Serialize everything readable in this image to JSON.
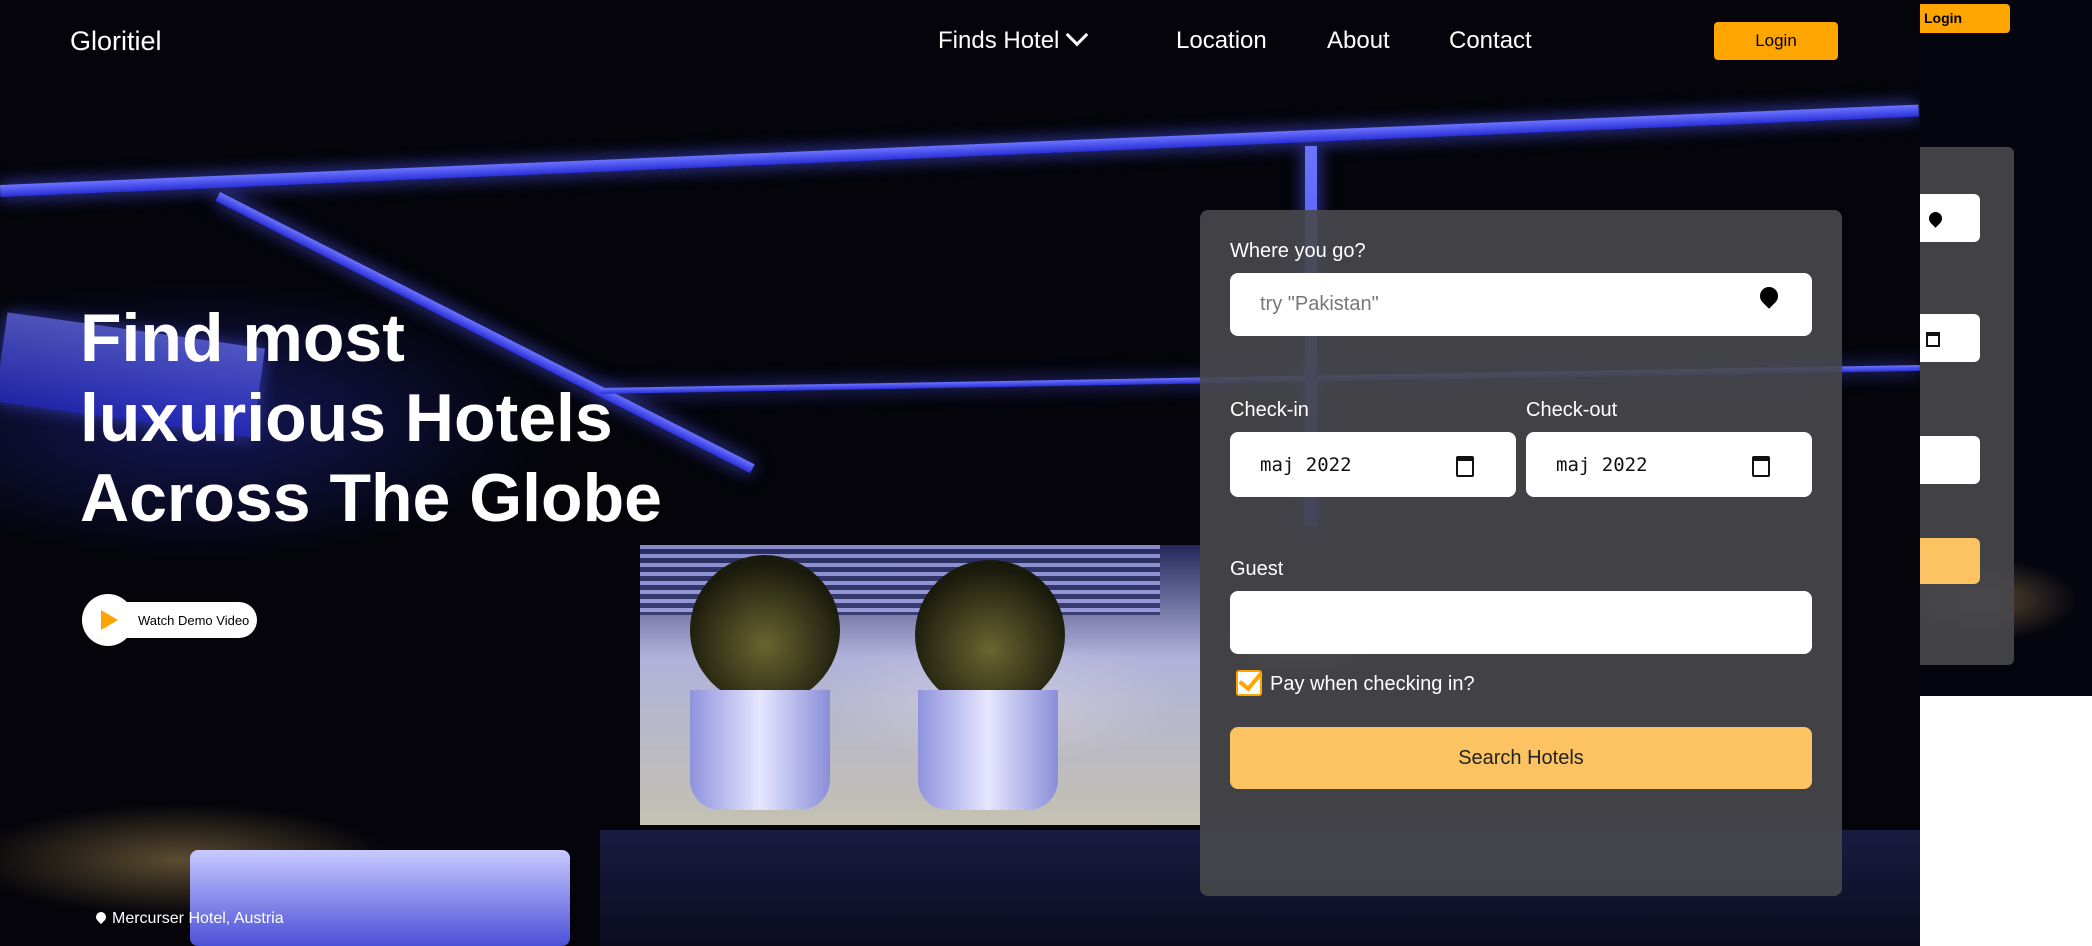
{
  "nav": {
    "brand": "Gloritiel",
    "items": [
      "Finds Hotel",
      "Location",
      "About",
      "Contact"
    ],
    "login": "Login"
  },
  "hero": {
    "headline": [
      "Find most",
      "luxurious Hotels",
      "Across The Globe"
    ],
    "demo_label": "Watch Demo Video",
    "location": "Mercurser Hotel, Austria"
  },
  "booking": {
    "where_label": "Where you go?",
    "where_placeholder": "try \"Pakistan\"",
    "checkin_label": "Check-in",
    "checkin_value": "maj 2022",
    "checkout_label": "Check-out",
    "checkout_value": "maj 2022",
    "guest_label": "Guest",
    "guest_value": "",
    "pay_label": "Pay when checking in?",
    "pay_checked": true,
    "search_button": "Search Hotels"
  },
  "duplicate": {
    "login": "Login"
  },
  "colors": {
    "accent": "#ffa500",
    "button": "#fbc361",
    "card": "#48484c"
  }
}
